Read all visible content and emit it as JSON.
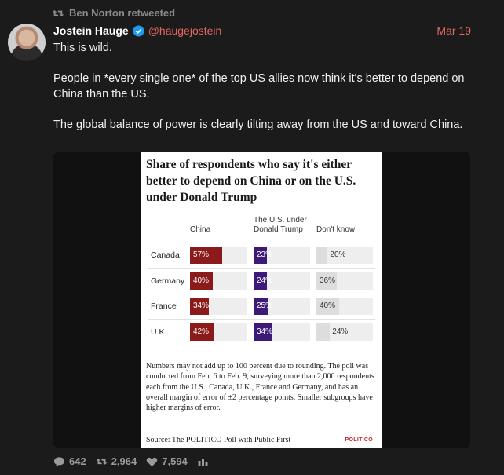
{
  "retweet": {
    "text": "Ben Norton retweeted"
  },
  "tweet": {
    "author_name": "Jostein Hauge",
    "handle": "@haugejostein",
    "date": "Mar 19",
    "paragraphs": [
      "This is wild.",
      "People in *every single one* of the top US allies now think it's better to depend on China than the US.",
      "The global balance of power is clearly tilting away from the US and toward China."
    ]
  },
  "chart_data": {
    "type": "bar",
    "title": "Share of respondents who say it's either better to depend on China or on the U.S. under Donald Trump",
    "columns": [
      "China",
      "The U.S. under Donald Trump",
      "Don't know"
    ],
    "categories": [
      "Canada",
      "Germany",
      "France",
      "U.K."
    ],
    "series": [
      {
        "name": "China",
        "values": [
          57,
          40,
          34,
          42
        ],
        "color": "#8b1a1a"
      },
      {
        "name": "The U.S. under Donald Trump",
        "values": [
          23,
          24,
          25,
          34
        ],
        "color": "#3d1a78"
      },
      {
        "name": "Don't know",
        "values": [
          20,
          36,
          40,
          24
        ],
        "color": "#dddddd"
      }
    ],
    "value_suffix": "%",
    "note": "Numbers may not add up to 100 percent due to rounding. The poll was conducted from Feb. 6 to Feb. 9, surveying more than 2,000 respondents each from the U.S., Canada, U.K., France and Germany, and has an overall margin of error of ±2 percentage points. Smaller subgroups have higher margins of error.",
    "source": "Source: The POLITICO Poll with Public First",
    "brand": "POLITICO"
  },
  "actions": {
    "replies": "642",
    "retweets": "2,964",
    "likes": "7,594"
  },
  "icons": [
    "retweet-icon",
    "verified-badge-icon",
    "reply-icon",
    "like-icon",
    "analytics-icon"
  ],
  "colors": {
    "accent": "#e0685f",
    "china": "#8b1a1a",
    "us": "#3d1a78",
    "dontknow": "#dddddd"
  }
}
